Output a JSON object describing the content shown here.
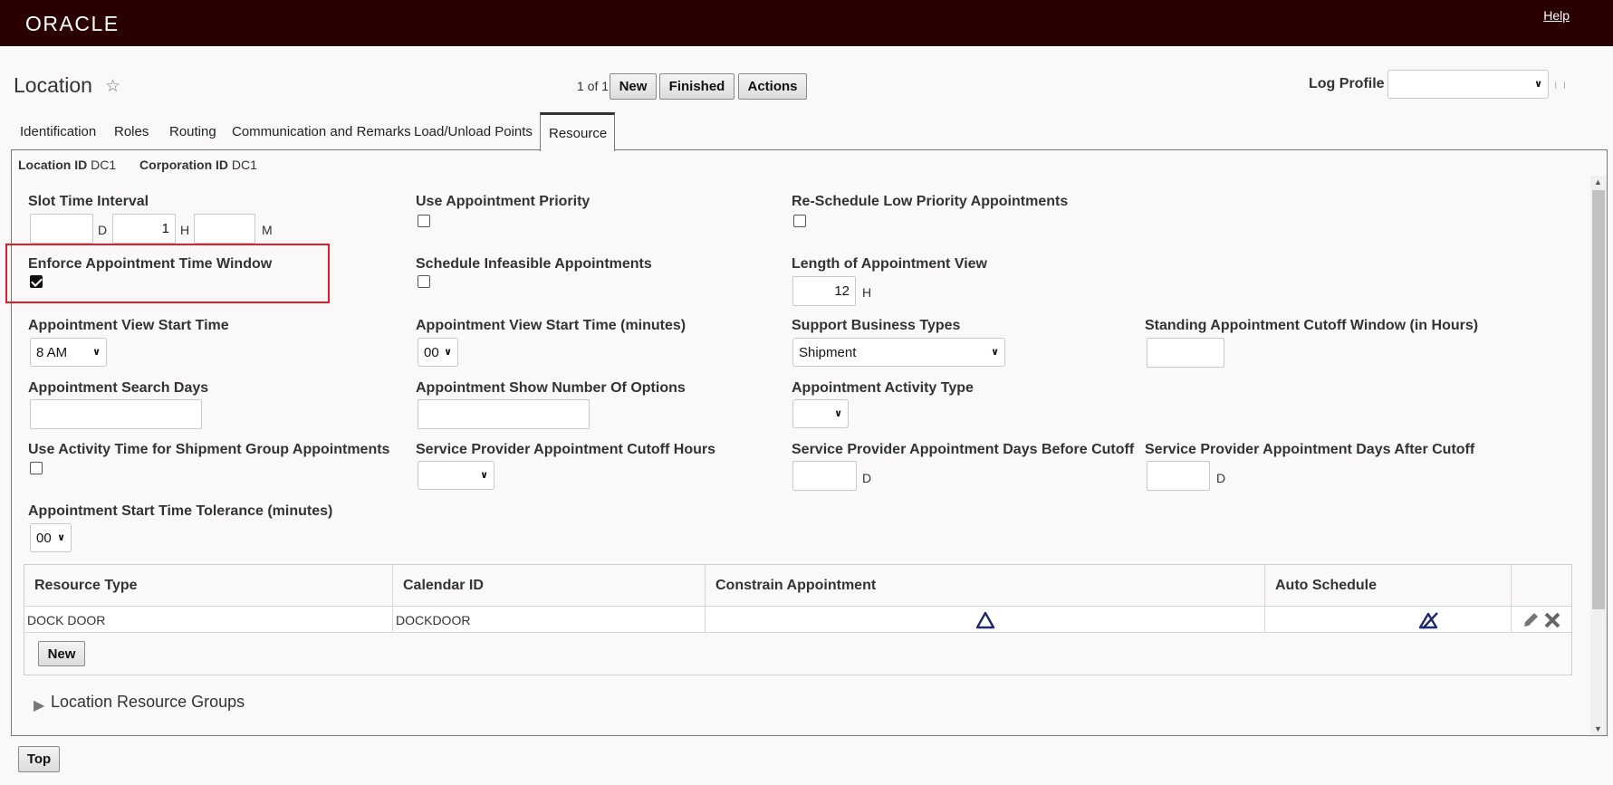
{
  "header": {
    "logo": "ORACLE",
    "help": "Help"
  },
  "page": {
    "title": "Location",
    "pager": "1 of 1"
  },
  "toolbar": {
    "new": "New",
    "finished": "Finished",
    "actions": "Actions"
  },
  "log_profile": {
    "label": "Log Profile",
    "value": ""
  },
  "tabs": [
    {
      "label": "Identification"
    },
    {
      "label": "Roles"
    },
    {
      "label": "Routing"
    },
    {
      "label": "Communication and Remarks"
    },
    {
      "label": "Load/Unload Points"
    },
    {
      "label": "Resource"
    }
  ],
  "ids": {
    "location_label": "Location ID",
    "location_value": "DC1",
    "corporation_label": "Corporation ID",
    "corporation_value": "DC1"
  },
  "fields": {
    "slot_time_interval": {
      "label": "Slot Time Interval",
      "days": "",
      "hours": "1",
      "minutes": "",
      "unit_d": "D",
      "unit_h": "H",
      "unit_m": "M"
    },
    "use_appt_priority": {
      "label": "Use Appointment Priority",
      "checked": false
    },
    "reschedule_low_priority": {
      "label": "Re-Schedule Low Priority Appointments",
      "checked": false
    },
    "enforce_time_window": {
      "label": "Enforce Appointment Time Window",
      "checked": true
    },
    "schedule_infeasible": {
      "label": "Schedule Infeasible Appointments",
      "checked": false
    },
    "length_of_view": {
      "label": "Length of Appointment View",
      "value": "12",
      "unit": "H"
    },
    "view_start_time": {
      "label": "Appointment View Start Time",
      "value": "8 AM"
    },
    "view_start_minutes": {
      "label": "Appointment View Start Time (minutes)",
      "value": "00"
    },
    "support_business_types": {
      "label": "Support Business Types",
      "value": "Shipment"
    },
    "standing_cutoff": {
      "label": "Standing Appointment Cutoff Window (in Hours)",
      "value": ""
    },
    "search_days": {
      "label": "Appointment Search Days",
      "value": ""
    },
    "show_number_options": {
      "label": "Appointment Show Number Of Options",
      "value": ""
    },
    "activity_type": {
      "label": "Appointment Activity Type",
      "value": ""
    },
    "activity_time_shipment_group": {
      "label": "Use Activity Time for Shipment Group Appointments",
      "checked": false
    },
    "sp_cutoff_hours": {
      "label": "Service Provider Appointment Cutoff Hours",
      "value": ""
    },
    "sp_days_before": {
      "label": "Service Provider Appointment Days Before Cutoff",
      "value": "",
      "unit": "D"
    },
    "sp_days_after": {
      "label": "Service Provider Appointment Days After Cutoff",
      "value": "",
      "unit": "D"
    },
    "start_tolerance": {
      "label": "Appointment Start Time Tolerance (minutes)",
      "value": "00"
    }
  },
  "resource_table": {
    "headers": [
      "Resource Type",
      "Calendar ID",
      "Constrain Appointment",
      "Auto Schedule"
    ],
    "rows": [
      {
        "resource_type": "DOCK DOOR",
        "calendar_id": "DOCKDOOR"
      }
    ],
    "new_button": "New"
  },
  "sections": {
    "resource_groups": "Location Resource Groups"
  },
  "footer": {
    "top_button": "Top"
  }
}
